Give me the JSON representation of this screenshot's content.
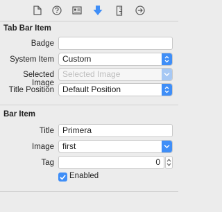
{
  "toolbar": {
    "icons": [
      "file-icon",
      "help-icon",
      "identity-card-icon",
      "attributes-arrow-icon",
      "ruler-icon",
      "connections-arrow-icon"
    ]
  },
  "tab_bar_item": {
    "title": "Tab Bar Item",
    "badge_label": "Badge",
    "badge_value": "",
    "system_item_label": "System Item",
    "system_item_value": "Custom",
    "selected_image_label": "Selected Image",
    "selected_image_placeholder": "Selected Image",
    "title_position_label": "Title Position",
    "title_position_value": "Default Position"
  },
  "bar_item": {
    "title": "Bar Item",
    "title_label": "Title",
    "title_value": "Primera",
    "image_label": "Image",
    "image_value": "first",
    "tag_label": "Tag",
    "tag_value": "0",
    "enabled_label": "Enabled",
    "enabled_checked": true
  },
  "colors": {
    "accent": "#3f8ef7",
    "background": "#ececec"
  }
}
